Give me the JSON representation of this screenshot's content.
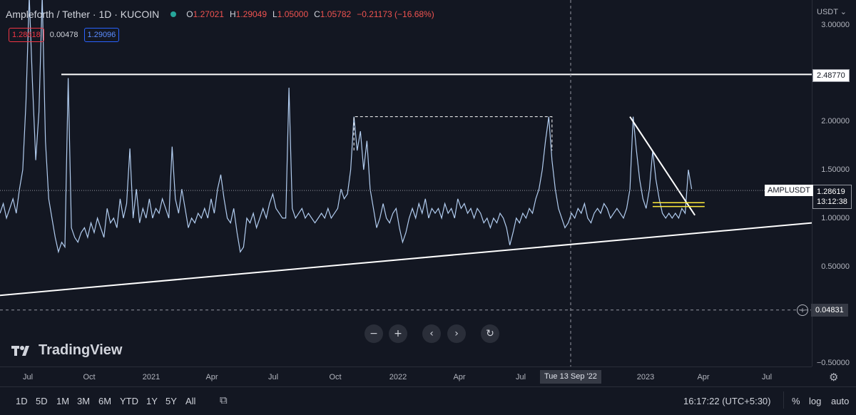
{
  "legend": {
    "symbol": "Ampleforth / Tether · 1D · KUCOIN",
    "open_key": "O",
    "open": "1.27021",
    "high_key": "H",
    "high": "1.29049",
    "low_key": "L",
    "low": "1.05000",
    "close_key": "C",
    "close": "1.05782",
    "change": "−0.21173 (−16.68%)",
    "status_color": "#26a69a",
    "down_color": "#ef5350"
  },
  "indicators": {
    "value_red": "1.28618",
    "value_plain": "0.00478",
    "value_blue": "1.29096",
    "red_color": "#f23645",
    "blue_color": "#2962ff"
  },
  "price_scale": {
    "currency": "USDT",
    "ticks": [
      "3.00000",
      "2.00000",
      "1.50000",
      "1.00000",
      "0.50000",
      "−0.50000"
    ],
    "labels": {
      "resistance": "2.48770",
      "symbol_tag": "AMPLUSDT",
      "last_price": "1.28619",
      "countdown": "13:12:38",
      "crosshair_price": "0.04831"
    }
  },
  "time_scale": {
    "labels": [
      "Jul",
      "Oct",
      "2021",
      "Apr",
      "Jul",
      "Oct",
      "2022",
      "Apr",
      "Jul",
      "2023",
      "Apr",
      "Jul"
    ],
    "crosshair_time": "Tue 13 Sep '22"
  },
  "bottom_bar": {
    "ranges": [
      "1D",
      "5D",
      "1M",
      "3M",
      "6M",
      "YTD",
      "1Y",
      "5Y",
      "All"
    ],
    "clock": "16:17:22 (UTC+5:30)",
    "percent": "%",
    "log": "log",
    "auto": "auto"
  },
  "nav": {
    "zoom_out": "−",
    "zoom_in": "+",
    "scroll_left": "‹",
    "scroll_right": "›",
    "reset": "↻"
  },
  "watermark": {
    "text": "TradingView"
  },
  "chart_data": {
    "type": "line",
    "title": "Ampleforth / Tether · 1D · KUCOIN",
    "xlabel": "",
    "ylabel": "",
    "x_range": [
      "2020-06",
      "2023-08"
    ],
    "ylim": [
      -0.5,
      3.1
    ],
    "color": "#b2cdf0",
    "series": [
      {
        "values": [
          [
            0.0,
            1.05
          ],
          [
            0.004,
            1.15
          ],
          [
            0.008,
            1.0
          ],
          [
            0.012,
            1.1
          ],
          [
            0.016,
            1.2
          ],
          [
            0.02,
            1.05
          ],
          [
            0.024,
            1.3
          ],
          [
            0.028,
            1.5
          ],
          [
            0.032,
            2.2
          ],
          [
            0.036,
            3.6
          ],
          [
            0.04,
            2.4
          ],
          [
            0.044,
            1.6
          ],
          [
            0.048,
            2.1
          ],
          [
            0.052,
            3.3
          ],
          [
            0.056,
            1.8
          ],
          [
            0.06,
            1.2
          ],
          [
            0.064,
            1.0
          ],
          [
            0.068,
            0.8
          ],
          [
            0.072,
            0.65
          ],
          [
            0.076,
            0.75
          ],
          [
            0.08,
            0.7
          ],
          [
            0.084,
            2.45
          ],
          [
            0.088,
            0.9
          ],
          [
            0.092,
            0.8
          ],
          [
            0.096,
            0.75
          ],
          [
            0.1,
            0.85
          ],
          [
            0.104,
            0.9
          ],
          [
            0.108,
            0.8
          ],
          [
            0.112,
            0.95
          ],
          [
            0.116,
            0.85
          ],
          [
            0.12,
            1.0
          ],
          [
            0.124,
            0.9
          ],
          [
            0.128,
            0.8
          ],
          [
            0.132,
            1.1
          ],
          [
            0.136,
            0.95
          ],
          [
            0.14,
            1.0
          ],
          [
            0.144,
            0.9
          ],
          [
            0.148,
            1.2
          ],
          [
            0.152,
            1.0
          ],
          [
            0.156,
            1.15
          ],
          [
            0.16,
            1.72
          ],
          [
            0.164,
            1.0
          ],
          [
            0.168,
            1.3
          ],
          [
            0.172,
            0.95
          ],
          [
            0.176,
            1.1
          ],
          [
            0.18,
            1.0
          ],
          [
            0.184,
            1.2
          ],
          [
            0.188,
            1.0
          ],
          [
            0.192,
            1.1
          ],
          [
            0.196,
            1.05
          ],
          [
            0.2,
            1.2
          ],
          [
            0.204,
            1.1
          ],
          [
            0.208,
            1.0
          ],
          [
            0.212,
            1.74
          ],
          [
            0.216,
            1.2
          ],
          [
            0.22,
            1.05
          ],
          [
            0.224,
            1.3
          ],
          [
            0.228,
            1.1
          ],
          [
            0.232,
            0.9
          ],
          [
            0.236,
            1.0
          ],
          [
            0.24,
            0.95
          ],
          [
            0.244,
            1.05
          ],
          [
            0.248,
            1.0
          ],
          [
            0.252,
            1.1
          ],
          [
            0.256,
            1.0
          ],
          [
            0.26,
            1.2
          ],
          [
            0.264,
            1.05
          ],
          [
            0.268,
            1.3
          ],
          [
            0.272,
            1.45
          ],
          [
            0.276,
            1.2
          ],
          [
            0.28,
            1.0
          ],
          [
            0.284,
            0.95
          ],
          [
            0.288,
            1.1
          ],
          [
            0.292,
            0.85
          ],
          [
            0.296,
            0.65
          ],
          [
            0.3,
            0.7
          ],
          [
            0.304,
            1.0
          ],
          [
            0.308,
            0.95
          ],
          [
            0.312,
            1.05
          ],
          [
            0.316,
            0.9
          ],
          [
            0.32,
            1.0
          ],
          [
            0.324,
            1.1
          ],
          [
            0.328,
            1.0
          ],
          [
            0.332,
            1.15
          ],
          [
            0.336,
            1.25
          ],
          [
            0.34,
            1.1
          ],
          [
            0.344,
            1.05
          ],
          [
            0.348,
            1.0
          ],
          [
            0.352,
            1.0
          ],
          [
            0.356,
            2.35
          ],
          [
            0.36,
            1.1
          ],
          [
            0.364,
            1.0
          ],
          [
            0.368,
            1.05
          ],
          [
            0.372,
            1.1
          ],
          [
            0.376,
            1.0
          ],
          [
            0.38,
            1.05
          ],
          [
            0.384,
            1.0
          ],
          [
            0.388,
            0.95
          ],
          [
            0.392,
            1.0
          ],
          [
            0.396,
            1.05
          ],
          [
            0.4,
            1.0
          ],
          [
            0.404,
            1.1
          ],
          [
            0.408,
            1.0
          ],
          [
            0.412,
            1.05
          ],
          [
            0.416,
            1.1
          ],
          [
            0.42,
            1.3
          ],
          [
            0.424,
            1.2
          ],
          [
            0.428,
            1.25
          ],
          [
            0.432,
            1.5
          ],
          [
            0.436,
            2.05
          ],
          [
            0.44,
            1.7
          ],
          [
            0.444,
            1.9
          ],
          [
            0.448,
            1.5
          ],
          [
            0.452,
            1.8
          ],
          [
            0.456,
            1.3
          ],
          [
            0.46,
            1.1
          ],
          [
            0.464,
            0.9
          ],
          [
            0.468,
            1.0
          ],
          [
            0.472,
            1.15
          ],
          [
            0.476,
            1.0
          ],
          [
            0.48,
            0.95
          ],
          [
            0.484,
            1.05
          ],
          [
            0.488,
            1.1
          ],
          [
            0.492,
            0.9
          ],
          [
            0.496,
            0.75
          ],
          [
            0.5,
            0.85
          ],
          [
            0.504,
            1.0
          ],
          [
            0.508,
            1.1
          ],
          [
            0.512,
            1.0
          ],
          [
            0.516,
            1.15
          ],
          [
            0.52,
            1.05
          ],
          [
            0.524,
            1.2
          ],
          [
            0.528,
            1.0
          ],
          [
            0.532,
            1.1
          ],
          [
            0.536,
            1.05
          ],
          [
            0.54,
            1.1
          ],
          [
            0.544,
            1.0
          ],
          [
            0.548,
            1.15
          ],
          [
            0.552,
            1.05
          ],
          [
            0.556,
            1.1
          ],
          [
            0.56,
            1.0
          ],
          [
            0.564,
            1.2
          ],
          [
            0.568,
            1.1
          ],
          [
            0.572,
            1.15
          ],
          [
            0.576,
            1.05
          ],
          [
            0.58,
            1.1
          ],
          [
            0.584,
            1.0
          ],
          [
            0.588,
            1.1
          ],
          [
            0.592,
            1.05
          ],
          [
            0.596,
            0.95
          ],
          [
            0.6,
            1.0
          ],
          [
            0.604,
            0.9
          ],
          [
            0.608,
            1.0
          ],
          [
            0.612,
            0.95
          ],
          [
            0.616,
            1.05
          ],
          [
            0.62,
            1.0
          ],
          [
            0.624,
            0.9
          ],
          [
            0.628,
            0.72
          ],
          [
            0.632,
            0.85
          ],
          [
            0.636,
            1.0
          ],
          [
            0.64,
            0.95
          ],
          [
            0.644,
            1.05
          ],
          [
            0.648,
            1.0
          ],
          [
            0.652,
            1.1
          ],
          [
            0.656,
            1.05
          ],
          [
            0.66,
            1.2
          ],
          [
            0.664,
            1.3
          ],
          [
            0.668,
            1.5
          ],
          [
            0.672,
            1.8
          ],
          [
            0.676,
            2.05
          ],
          [
            0.68,
            1.6
          ],
          [
            0.684,
            1.3
          ],
          [
            0.688,
            1.1
          ],
          [
            0.692,
            1.0
          ],
          [
            0.696,
            0.9
          ],
          [
            0.7,
            0.95
          ],
          [
            0.704,
            1.05
          ],
          [
            0.708,
            1.0
          ],
          [
            0.712,
            1.1
          ],
          [
            0.716,
            1.05
          ],
          [
            0.72,
            1.15
          ],
          [
            0.724,
            1.0
          ],
          [
            0.728,
            0.95
          ],
          [
            0.732,
            1.05
          ],
          [
            0.736,
            1.1
          ],
          [
            0.74,
            1.05
          ],
          [
            0.744,
            1.15
          ],
          [
            0.748,
            1.1
          ],
          [
            0.752,
            1.0
          ],
          [
            0.756,
            1.05
          ],
          [
            0.76,
            1.1
          ],
          [
            0.764,
            1.05
          ],
          [
            0.768,
            1.0
          ],
          [
            0.772,
            1.1
          ],
          [
            0.776,
            1.3
          ],
          [
            0.78,
            2.05
          ],
          [
            0.784,
            1.7
          ],
          [
            0.788,
            1.4
          ],
          [
            0.792,
            1.2
          ],
          [
            0.796,
            1.1
          ],
          [
            0.8,
            1.3
          ],
          [
            0.804,
            1.7
          ],
          [
            0.808,
            1.4
          ],
          [
            0.812,
            1.2
          ],
          [
            0.816,
            1.05
          ],
          [
            0.82,
            1.0
          ],
          [
            0.824,
            1.05
          ],
          [
            0.828,
            1.0
          ],
          [
            0.832,
            1.05
          ],
          [
            0.836,
            1.0
          ],
          [
            0.84,
            1.1
          ],
          [
            0.844,
            1.05
          ],
          [
            0.848,
            1.5
          ],
          [
            0.852,
            1.3
          ]
        ]
      }
    ],
    "annotations": {
      "resistance_level": 2.4877,
      "support_trendline": {
        "from": [
          0.0,
          0.2
        ],
        "to": [
          1.0,
          0.95
        ]
      },
      "descending_trendline": {
        "from": [
          0.776,
          2.05
        ],
        "to": [
          0.856,
          1.03
        ]
      },
      "dashed_box": {
        "x": [
          0.436,
          0.68
        ],
        "top": 2.05
      },
      "yellow_zone": {
        "x": [
          0.804,
          0.868
        ],
        "levels": [
          1.12,
          1.16
        ]
      },
      "last_price_line": 1.28619,
      "crosshair_price_line": 0.04831,
      "crosshair_time_x": 0.703
    }
  }
}
